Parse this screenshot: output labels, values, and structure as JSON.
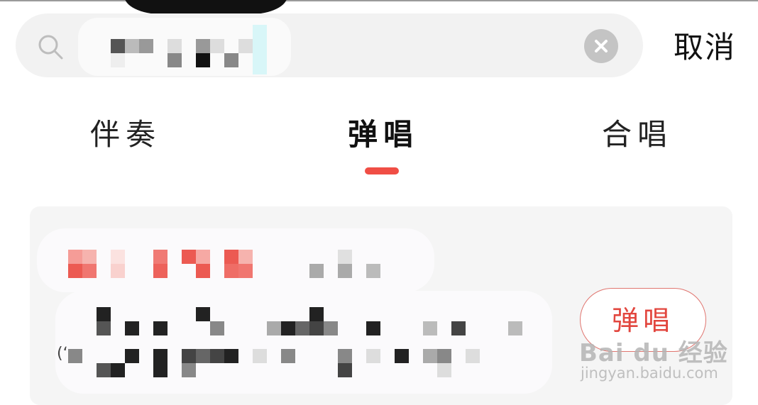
{
  "search": {
    "value": "",
    "placeholder": ""
  },
  "header": {
    "cancel_label": "取消"
  },
  "tabs": [
    {
      "label": "伴奏",
      "active": false
    },
    {
      "label": "弹唱",
      "active": true
    },
    {
      "label": "合唱",
      "active": false
    }
  ],
  "result": {
    "action_label": "弹唱",
    "fragment": "(ʻ"
  },
  "watermark": {
    "logo_text": "Bai du 经验",
    "url_text": "jingyan.baidu.com"
  },
  "colors": {
    "accent": "#f04e45",
    "search_bg": "#f2f2f2",
    "card_bg": "#f5f5f5"
  }
}
